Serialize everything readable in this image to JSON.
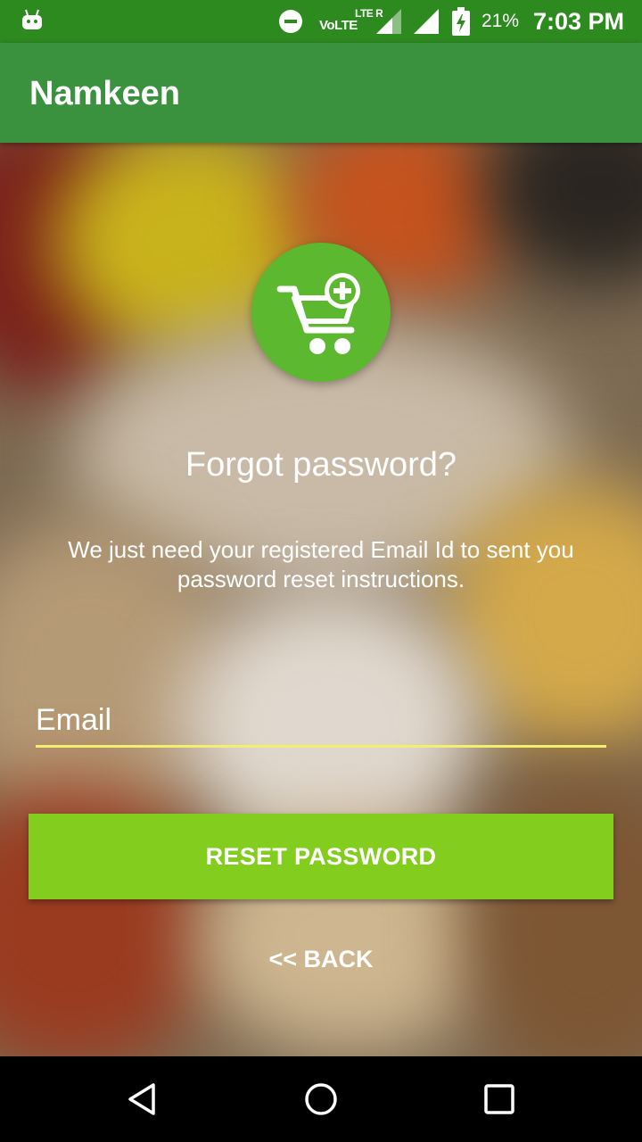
{
  "status_bar": {
    "network_label": "VoLTE",
    "lte_label": "LTE R",
    "battery_percent": "21%",
    "time": "7:03 PM",
    "icons": [
      "android-icon",
      "do-not-disturb-icon",
      "signal-icon",
      "battery-charging-icon"
    ]
  },
  "app_bar": {
    "title": "Namkeen"
  },
  "main": {
    "logo_icon": "add-to-cart-icon",
    "heading": "Forgot password?",
    "description": "We just need your registered Email Id to sent you password reset instructions.",
    "email": {
      "placeholder": "Email",
      "value": ""
    },
    "reset_button_label": "RESET PASSWORD",
    "back_label": "<< BACK"
  },
  "nav_bar": {
    "icons": [
      "back-triangle-icon",
      "home-circle-icon",
      "recents-square-icon"
    ]
  },
  "colors": {
    "status_bar": "#2d8a1f",
    "app_bar": "#3b923e",
    "accent_button": "#82cd1e",
    "logo_circle": "#5cb82f",
    "field_underline": "#f2ee70"
  }
}
